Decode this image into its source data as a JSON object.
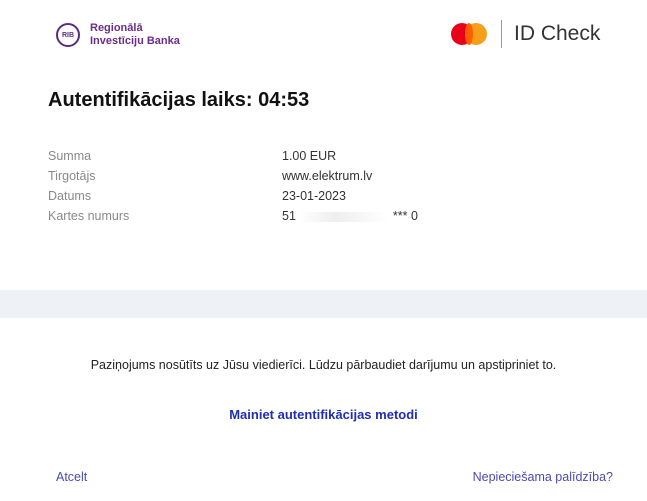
{
  "header": {
    "bank_badge": "RIB",
    "bank_name_line1": "Regionālā",
    "bank_name_line2": "Investīciju Banka",
    "scheme_label": "ID Check",
    "mastercard_colors": {
      "red": "#eb001b",
      "yellow": "#f79e1b"
    }
  },
  "title": "Autentifikācijas laiks: 04:53",
  "details": [
    {
      "label": "Summa",
      "value": "1.00 EUR"
    },
    {
      "label": "Tirgotājs",
      "value": "www.elektrum.lv"
    },
    {
      "label": "Datums",
      "value": "23-01-2023"
    },
    {
      "label": "Kartes numurs",
      "value_prefix": "51",
      "value_masked": "*** ",
      "value_suffix": "0"
    }
  ],
  "notice": "Paziņojums nosūtīts uz Jūsu viedierīci. Lūdzu pārbaudiet darījumu un apstipriniet to.",
  "change_method_link": "Mainiet autentifikācijas metodi",
  "cancel_link": "Atcelt",
  "help_link": "Nepieciešama palīdzība?"
}
